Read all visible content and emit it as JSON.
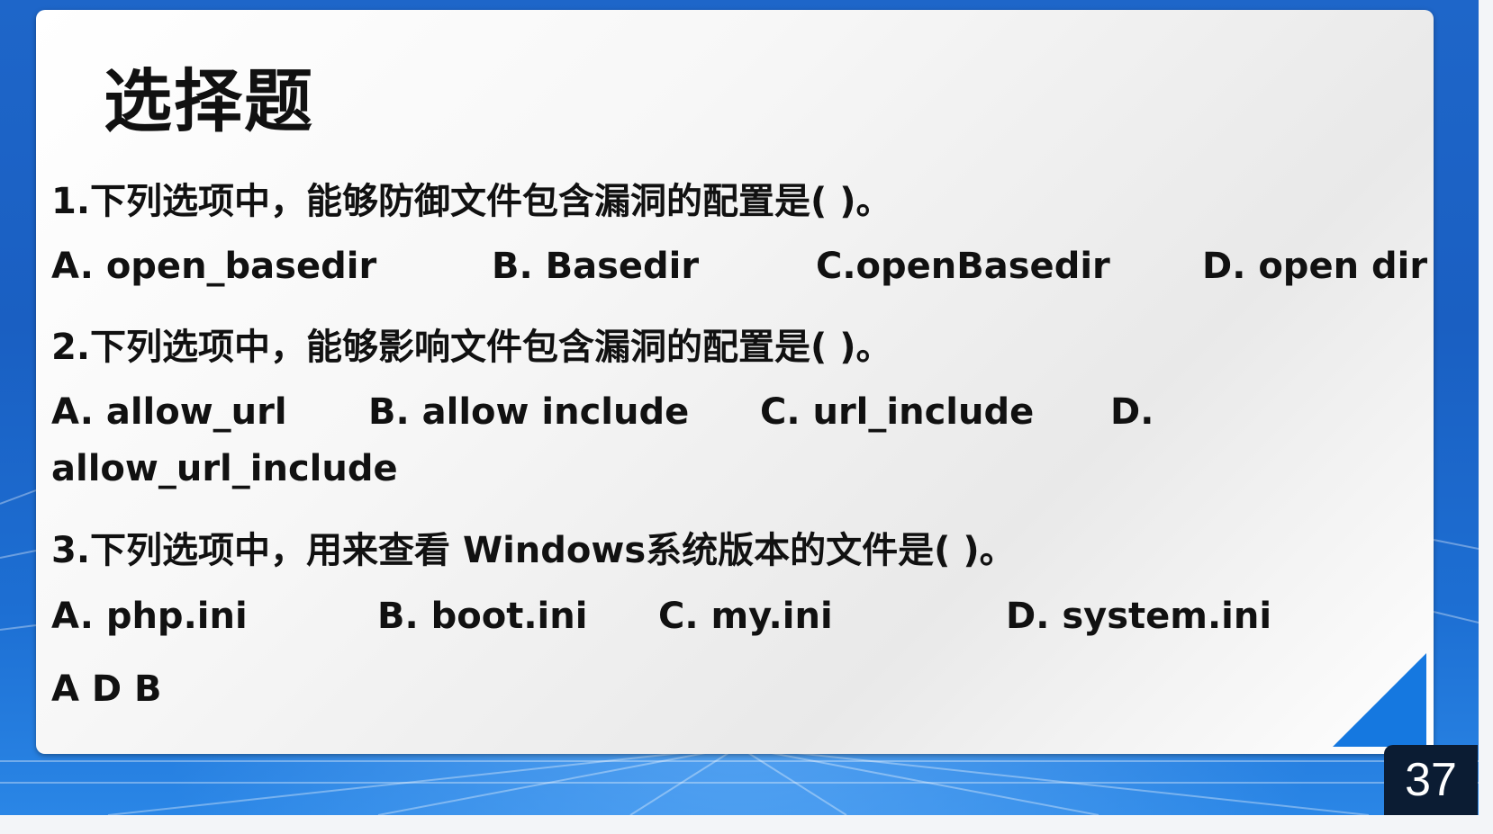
{
  "title": "选择题",
  "questions": [
    {
      "text": "1.下列选项中，能够防御文件包含漏洞的配置是(   )。",
      "options": [
        "A. open_basedir",
        "B. Basedir",
        "C.openBasedir",
        "D. open dir"
      ]
    },
    {
      "text": "2.下列选项中，能够影响文件包含漏洞的配置是(   )。",
      "options": [
        "A. allow_url",
        "B. allow include",
        "C. url_include",
        "D.",
        "allow_url_include"
      ]
    },
    {
      "text": "3.下列选项中，用来查看 Windows系统版本的文件是(   )。",
      "options": [
        "A.  php.ini",
        "B. boot.ini",
        "C. my.ini",
        "D. system.ini"
      ]
    }
  ],
  "answer": "A D B",
  "page_number": "37",
  "colors": {
    "background_blue": "#1e66c9",
    "accent_blue": "#1578e0",
    "badge_bg": "#0b1c33",
    "text": "#111111"
  }
}
